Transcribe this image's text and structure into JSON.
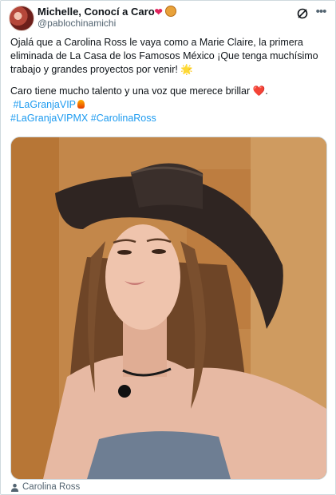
{
  "tweet": {
    "author_name": "Michelle, Conocí a Caro",
    "author_emojis": [
      "heart",
      "lion"
    ],
    "handle": "@pablochinamichi",
    "text_line1": "Ojalá que a Carolina Ross le vaya como a Marie Claire, la primera eliminada de La Casa de los Famosos México  ¡Que tenga muchísimo trabajo y grandes proyectos por venir!",
    "text_line1_emoji": "🌟",
    "text_line2": "Caro tiene mucho talento y una voz que merece brillar",
    "text_line2_emoji": "❤️",
    "text_line2_end": ".",
    "hashtag1": "#LaGranjaVIP",
    "hashtag2": "#LaGranjaVIPMX",
    "hashtag3": "#CarolinaRoss",
    "media_tag": "Carolina Ross"
  },
  "icons": {
    "grok": "grok-icon",
    "more": "more-icon",
    "person": "person-icon"
  },
  "colors": {
    "link": "#1d9bf0",
    "secondary_text": "#536471",
    "border": "#cfd9de"
  }
}
